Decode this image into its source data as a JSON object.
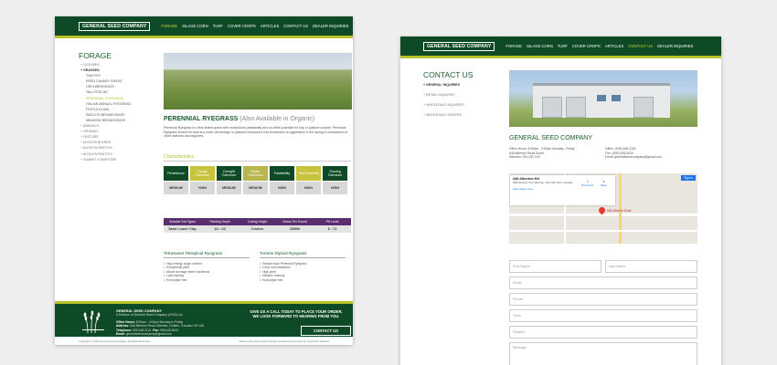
{
  "nav": {
    "logo": "GENERAL SEED COMPANY",
    "links": [
      "FORAGE",
      "SILAGE CORN",
      "TURF",
      "COVER CROPS",
      "ARTICLES",
      "CONTACT US",
      "DEALER INQUIRIES"
    ]
  },
  "page1": {
    "active_nav": "FORAGE",
    "side_title": "FORAGE",
    "sidebar": [
      {
        "label": "LEGUMES",
        "kind": "top"
      },
      {
        "label": "GRASSES",
        "kind": "bold"
      },
      {
        "label": "TIMOTHY",
        "kind": "sub"
      },
      {
        "label": "REED CANARY GRASS",
        "kind": "sub"
      },
      {
        "label": "ORCHARDGRASS",
        "kind": "sub"
      },
      {
        "label": "TALL FESCUE",
        "kind": "sub"
      },
      {
        "label": "PERENNIAL RYEGRASS",
        "kind": "sub-active"
      },
      {
        "label": "ITALIAN ANNUAL RYEGRASS",
        "kind": "sub"
      },
      {
        "label": "FESTULOLIUM",
        "kind": "sub"
      },
      {
        "label": "SMOOTH BROMEGRASS",
        "kind": "sub"
      },
      {
        "label": "MEADOW BROMEGRASS",
        "kind": "sub"
      },
      {
        "label": "ANNUALS",
        "kind": "top"
      },
      {
        "label": "ORGANIC",
        "kind": "top"
      },
      {
        "label": "PASTURE",
        "kind": "top"
      },
      {
        "label": "ALFALFA BLENDS",
        "kind": "top"
      },
      {
        "label": "ALFALFA/TIMOTHY",
        "kind": "top"
      },
      {
        "label": "ALFALFA/TIMOTHY",
        "kind": "top"
      },
      {
        "label": "SUMMIT & MARITIME",
        "kind": "top"
      }
    ],
    "product_title": "PERENNIAL RYEGRASS",
    "product_alt": "(Also Available in Organic)",
    "description": "Perennial Ryegrass is a fine-leafed grass with exceptional palatability and no-effort potential for hay or pasture swards. Perennial Ryegrass should be kept at a lower percentage in pastured because it has tendencies to aggressive in the spring in comparison to other mixtures and legumes.",
    "characteristics_title": "Characteristics",
    "traits": [
      {
        "name": "Persistence",
        "value": "MEDIUM",
        "color": "#0e4a25"
      },
      {
        "name": "Forage Tolerance",
        "value": "HIGH",
        "color": "#c7c33a"
      },
      {
        "name": "Drought Tolerance",
        "value": "MEDIUM",
        "color": "#0e4a25"
      },
      {
        "name": "Winter Hardiness",
        "value": "MEDIUM",
        "color": "#b7b64a"
      },
      {
        "name": "Palatability",
        "value": "HIGH",
        "color": "#0e4a25"
      },
      {
        "name": "Yield Potential",
        "value": "HIGH",
        "color": "#c7c33a"
      },
      {
        "name": "Grazing Tolerance",
        "value": "HIGH",
        "color": "#0e4a25"
      }
    ],
    "props_head": [
      "Suitable Soil Types",
      "Planting Depth",
      "Cutting Height",
      "Seeds Per Pound",
      "PH Level"
    ],
    "props_val": [
      "Sand / Loam / Clay",
      "1/4 - 1/2",
      "3 inches",
      "230000",
      "6 - 7.5"
    ],
    "variety1": {
      "title": "Tetrasweet Tetraploid Ryegrass",
      "items": [
        "High energy sugar content",
        "Exceptional yield",
        "Above average winter hardiness",
        "Late maturity",
        "Endophyte free"
      ]
    },
    "variety2": {
      "title": "Toronto Diploid Ryegrass",
      "items": [
        "Pasture type Perennial Ryegrass",
        "Good rust resistance",
        "High yield",
        "Medium maturity",
        "Endophyte free"
      ]
    },
    "footer": {
      "name": "GENERAL SEED COMPANY",
      "sub": "A Division of General Seed Company (2003) Ltd.",
      "hours_label": "Office Hours:",
      "hours": "8:00am - 4:00pm Monday to Friday",
      "address_label": "Address:",
      "address": "648 Alberton Road, Alberton, Ontario, Canada L0R 1A0",
      "tel_label": "Telephone:",
      "tel": "905.648.2101",
      "fax_label": "Fax:",
      "fax": "905.648.5420",
      "email_label": "Email:",
      "email": "generalseedcompany@gmail.com",
      "cta1": "GIVE US A CALL TODAY TO PLACE YOUR ORDER.",
      "cta2": "WE LOOK FORWARD TO HEARING FROM YOU.",
      "button": "CONTACT US",
      "copyright": "Copyright © 2018 General Seed Company. All Rights Reserved.",
      "credit": "Designed by Fred Graphic Design Solutions and Hosted by SuperTech Network"
    }
  },
  "page2": {
    "active_nav": "CONTACT US",
    "side_title": "CONTACT US",
    "sidebar": [
      {
        "label": "GENERAL INQUIRIES",
        "kind": "bold"
      },
      {
        "label": "RETAIL INQUIRIES",
        "kind": "top"
      },
      {
        "label": "WHOLESALE INQUIRIES",
        "kind": "top"
      },
      {
        "label": "WHOLESALE ORDERS",
        "kind": "top"
      }
    ],
    "company": "GENERAL SEED COMPANY",
    "col1": [
      "Office Hours: 8:00am - 4:00pm Monday - Friday",
      "648 Alberton Road South",
      "Alberton, ON L0R 1A0"
    ],
    "col2": [
      "Office: (905) 648-2101",
      "Fax: (905) 648-5420",
      "Email: generalseedcompany@gmail.com"
    ],
    "map": {
      "place": "648 Alberton Rd",
      "address": "648 Alberton Rd, Alberton, ON L0R 1A0, Canada",
      "directions": "Directions",
      "save": "Save",
      "larger": "View larger map",
      "signin": "Sign in",
      "pin_label": "648 Alberton Road"
    },
    "form": {
      "first": "First Name",
      "last": "Last Name",
      "email": "Email",
      "phone": "Phone",
      "town": "Town",
      "subject": "Subject",
      "message": "Message"
    }
  }
}
